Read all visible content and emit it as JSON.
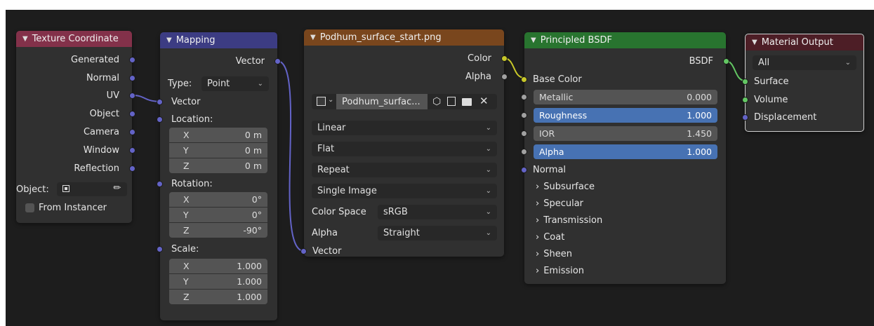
{
  "nodes": {
    "texcoord": {
      "title": "Texture Coordinate",
      "outputs": [
        "Generated",
        "Normal",
        "UV",
        "Object",
        "Camera",
        "Window",
        "Reflection"
      ],
      "object_label": "Object:",
      "from_instancer_label": "From Instancer"
    },
    "mapping": {
      "title": "Mapping",
      "output_vector": "Vector",
      "type_label": "Type:",
      "type_value": "Point",
      "input_vector": "Vector",
      "location_label": "Location:",
      "location": [
        {
          "axis": "X",
          "value": "0 m"
        },
        {
          "axis": "Y",
          "value": "0 m"
        },
        {
          "axis": "Z",
          "value": "0 m"
        }
      ],
      "rotation_label": "Rotation:",
      "rotation": [
        {
          "axis": "X",
          "value": "0°"
        },
        {
          "axis": "Y",
          "value": "0°"
        },
        {
          "axis": "Z",
          "value": "-90°"
        }
      ],
      "scale_label": "Scale:",
      "scale": [
        {
          "axis": "X",
          "value": "1.000"
        },
        {
          "axis": "Y",
          "value": "1.000"
        },
        {
          "axis": "Z",
          "value": "1.000"
        }
      ]
    },
    "image": {
      "title": "Podhum_surface_start.png",
      "output_color": "Color",
      "output_alpha": "Alpha",
      "image_name": "Podhum_surfac...",
      "interpolation": "Linear",
      "projection": "Flat",
      "extension": "Repeat",
      "source": "Single Image",
      "color_space_label": "Color Space",
      "color_space_value": "sRGB",
      "alpha_label": "Alpha",
      "alpha_value": "Straight",
      "input_vector": "Vector"
    },
    "bsdf": {
      "title": "Principled BSDF",
      "output": "BSDF",
      "base_color": "Base Color",
      "fields": [
        {
          "label": "Metallic",
          "value": "0.000"
        },
        {
          "label": "Roughness",
          "value": "1.000"
        },
        {
          "label": "IOR",
          "value": "1.450"
        },
        {
          "label": "Alpha",
          "value": "1.000"
        }
      ],
      "normal": "Normal",
      "panels": [
        "Subsurface",
        "Specular",
        "Transmission",
        "Coat",
        "Sheen",
        "Emission"
      ]
    },
    "output": {
      "title": "Material Output",
      "target": "All",
      "inputs": [
        "Surface",
        "Volume",
        "Displacement"
      ]
    }
  },
  "colors": {
    "texcoord_header": "#83314a",
    "mapping_header": "#3c3c83",
    "image_header": "#79461d",
    "bsdf_header": "#28742f",
    "output_header": "#4d1e26"
  }
}
